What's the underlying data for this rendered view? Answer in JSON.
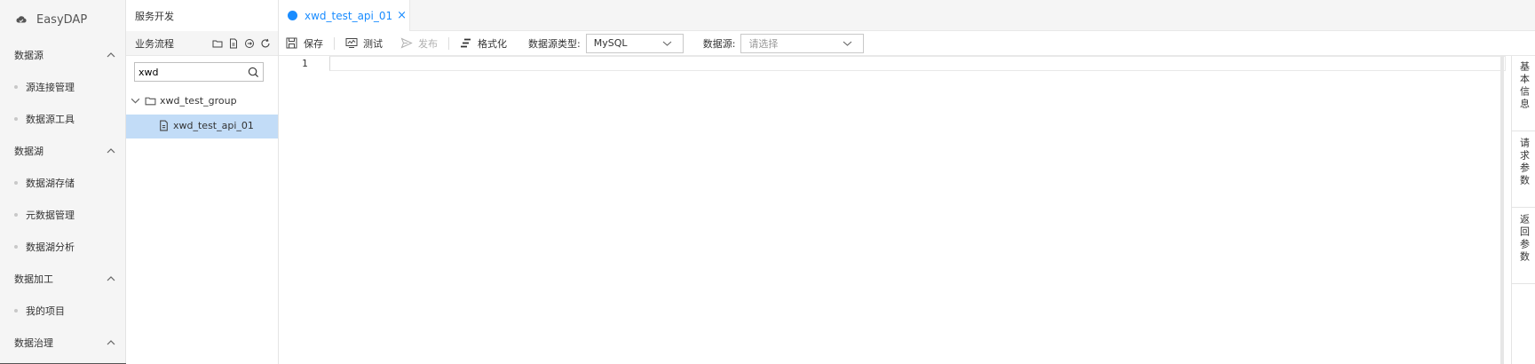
{
  "app": {
    "name": "EasyDAP"
  },
  "nav": {
    "groups": [
      {
        "label": "数据源",
        "items": [
          "源连接管理",
          "数据源工具"
        ]
      },
      {
        "label": "数据湖",
        "items": [
          "数据湖存储",
          "元数据管理",
          "数据湖分析"
        ]
      },
      {
        "label": "数据加工",
        "items": [
          "我的项目"
        ]
      },
      {
        "label": "数据治理",
        "items": []
      }
    ]
  },
  "tree": {
    "header": "服务开发",
    "section": "业务流程",
    "search_value": "xwd",
    "group_node": "xwd_test_group",
    "api_node": "xwd_test_api_01"
  },
  "tab": {
    "label": "xwd_test_api_01",
    "close": "×"
  },
  "toolbar": {
    "save": "保存",
    "test": "测试",
    "publish": "发布",
    "format": "格式化",
    "ds_type_label": "数据源类型:",
    "ds_type_value": "MySQL",
    "ds_label": "数据源:",
    "ds_placeholder": "请选择"
  },
  "editor": {
    "line_number": "1"
  },
  "side_tabs": [
    "基本信息",
    "请求参数",
    "返回参数"
  ],
  "colors": {
    "accent": "#1a8cff",
    "selected_row": "#c2dcf7"
  }
}
